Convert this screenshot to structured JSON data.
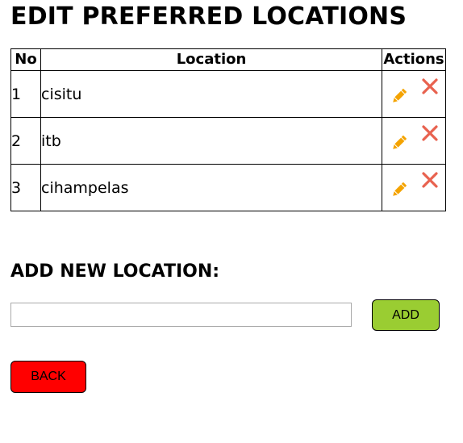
{
  "page": {
    "title": "EDIT PREFERRED LOCATIONS"
  },
  "table": {
    "headers": {
      "no": "No",
      "location": "Location",
      "actions": "Actions"
    },
    "rows": [
      {
        "no": "1",
        "location": "cisitu"
      },
      {
        "no": "2",
        "location": "itb"
      },
      {
        "no": "3",
        "location": "cihampelas"
      }
    ]
  },
  "add_section": {
    "title": "ADD NEW LOCATION:",
    "input_value": "",
    "add_label": "ADD"
  },
  "back_label": "BACK",
  "icons": {
    "edit": "pencil-icon",
    "delete": "close-icon"
  },
  "colors": {
    "edit_icon": "#f4a300",
    "delete_icon": "#e8624f",
    "add_button": "#9acd32",
    "back_button": "#ff0000"
  }
}
